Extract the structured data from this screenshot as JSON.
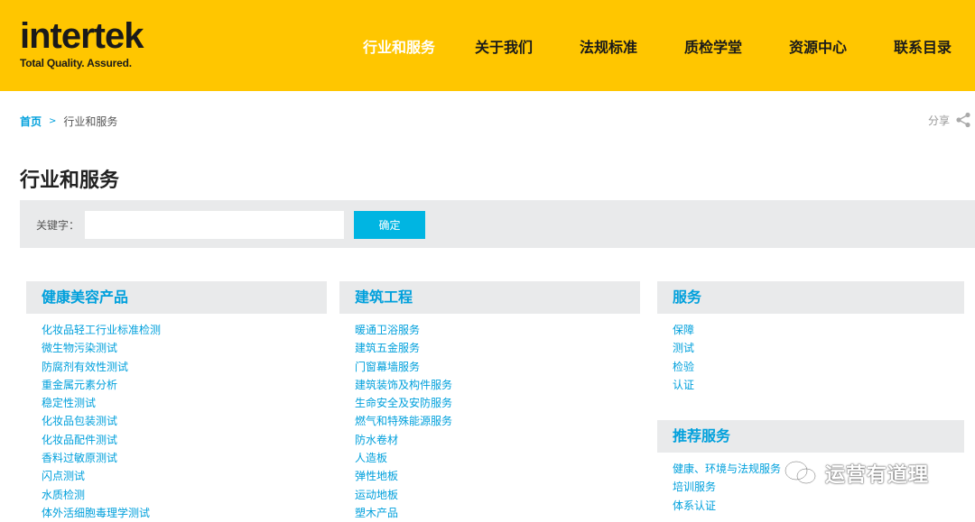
{
  "header": {
    "logo_word": "intertek",
    "logo_tagline": "Total Quality. Assured.",
    "nav": [
      "行业和服务",
      "关于我们",
      "法规标准",
      "质检学堂",
      "资源中心",
      "联系目录"
    ],
    "accent": "#ffc600"
  },
  "breadcrumb": {
    "home": "首页",
    "sep": ">",
    "current": "行业和服务"
  },
  "share": {
    "label": "分享"
  },
  "page": {
    "title": "行业和服务"
  },
  "search": {
    "label": "关键字：",
    "button": "确定",
    "value": ""
  },
  "categories": [
    {
      "title": "健康美容产品",
      "items": [
        "化妆品轻工行业标准检测",
        "微生物污染测试",
        "防腐剂有效性测试",
        "重金属元素分析",
        "稳定性测试",
        "化妆品包装测试",
        "化妆品配件测试",
        "香料过敏原测试",
        "闪点测试",
        "水质检测",
        "体外活细胞毒理学测试"
      ]
    },
    {
      "title": "建筑工程",
      "items": [
        "暖通卫浴服务",
        "建筑五金服务",
        "门窗幕墙服务",
        "建筑装饰及构件服务",
        "生命安全及安防服务",
        "燃气和特殊能源服务",
        "防水卷材",
        "人造板",
        "弹性地板",
        "运动地板",
        "塑木产品"
      ]
    },
    {
      "title": "服务",
      "items": [
        "保障",
        "测试",
        "检验",
        "认证"
      ]
    },
    {
      "title": "推荐服务",
      "items": [
        "健康、环境与法规服务",
        "培训服务",
        "体系认证"
      ]
    }
  ],
  "watermark": {
    "text": "运营有道理"
  },
  "colors": {
    "link": "#00a0dc",
    "button": "#00b5e2",
    "panel": "#e9eaeb"
  }
}
